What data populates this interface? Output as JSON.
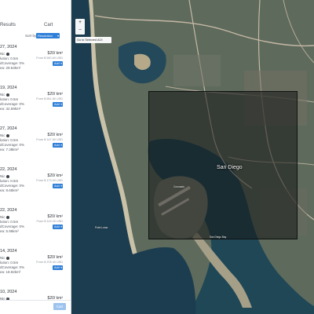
{
  "tabs": {
    "results": "Results",
    "cart": "Cart"
  },
  "sort": {
    "label": "Sort by",
    "value": "Resolution"
  },
  "results": [
    {
      "date": "27, 2024",
      "sensor": "Nic",
      "resolution": "lution: 0.5m",
      "cloud": "dCoverage: 0%",
      "area": "ea: 29.53km²",
      "price": "$20/ km²",
      "from": "From $ 590.60 USD",
      "add": "Add"
    },
    {
      "date": "19, 2024",
      "sensor": "Nic",
      "resolution": "lution: 0.5m",
      "cloud": "dCoverage: 0%",
      "area": "ea: 32.59km²",
      "price": "$20/ km²",
      "from": "From $ 651.80 USD",
      "add": "Add"
    },
    {
      "date": "27, 2024",
      "sensor": "Nic",
      "resolution": "lution: 0.5m",
      "cloud": "dCoverage: 0%",
      "area": "ea: 7.38km²",
      "price": "$20/ km²",
      "from": "From $ 147.60 USD",
      "add": "Add"
    },
    {
      "date": "22, 2024",
      "sensor": "Nic",
      "resolution": "lution: 0.5m",
      "cloud": "dCoverage: 0%",
      "area": "ea: 8.65km²",
      "price": "$20/ km²",
      "from": "From $ 173.00 USD",
      "add": "Add"
    },
    {
      "date": "22, 2024",
      "sensor": "Nic",
      "resolution": "lution: 0.5m",
      "cloud": "dCoverage: 0%",
      "area": "ea: 5.96km²",
      "price": "$20/ km²",
      "from": "From $ 119.20 USD",
      "add": "Add"
    },
    {
      "date": "14, 2024",
      "sensor": "Nic",
      "resolution": "lution: 0.5m",
      "cloud": "dCoverage: 0%",
      "area": "ea: 18.92km²",
      "price": "$20/ km²",
      "from": "From $ 378.40 USD",
      "add": "Add"
    },
    {
      "date": "10, 2024",
      "sensor": "Nic",
      "resolution": "lution: 0.5m",
      "cloud": "dCoverage: 21%",
      "area": "ea: 8.86km²",
      "price": "$20/ km²",
      "from": "From $ 177.20 USD",
      "add": "Add"
    }
  ],
  "footer": {
    "partial": "... ....",
    "cart_button": "Cart"
  },
  "map": {
    "zoom_in": "+",
    "zoom_out": "−",
    "go_aoi": "Go to Selected AOI",
    "city": "San Diego",
    "labels": [
      "Coronado",
      "San Diego Bay",
      "Point Loma"
    ]
  },
  "colors": {
    "accent": "#2f7fd8",
    "ocean": "#1c3d4f",
    "aoi_overlay": "#141616"
  }
}
